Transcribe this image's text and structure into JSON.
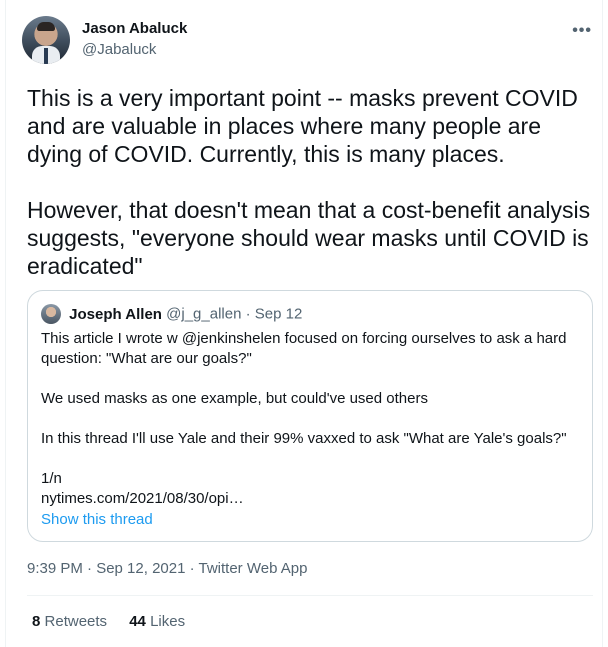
{
  "tweet": {
    "author_name": "Jason Abaluck",
    "author_handle": "@Jabaluck",
    "more_icon": "•••",
    "text_paragraphs": [
      "This is a very important point -- masks prevent COVID and are valuable in places where many people are dying of COVID. Currently, this is many places.",
      "However, that doesn't mean that a cost-benefit analysis suggests, \"everyone should wear masks until COVID is eradicated\""
    ],
    "timestamp": "9:39 PM · Sep 12, 2021 · Twitter Web App",
    "retweets_count": "8",
    "retweets_label": "Retweets",
    "likes_count": "44",
    "likes_label": "Likes"
  },
  "quoted": {
    "author_name": "Joseph Allen",
    "meta": "@j_g_allen · Sep 12",
    "paragraphs": [
      "This article I wrote w @jenkinshelen focused on forcing ourselves to ask a hard question: \"What are our goals?\"",
      "We used masks as one example, but could've used others",
      "In this thread I'll use Yale and their 99% vaxxed to ask \"What are Yale's goals?\"",
      "1/n\nnytimes.com/2021/08/30/opi…"
    ],
    "show_thread": "Show this thread"
  },
  "colors": {
    "text": "#0f1419",
    "secondary": "#536471",
    "link": "#1d9bf0",
    "border": "#cfd9de"
  }
}
